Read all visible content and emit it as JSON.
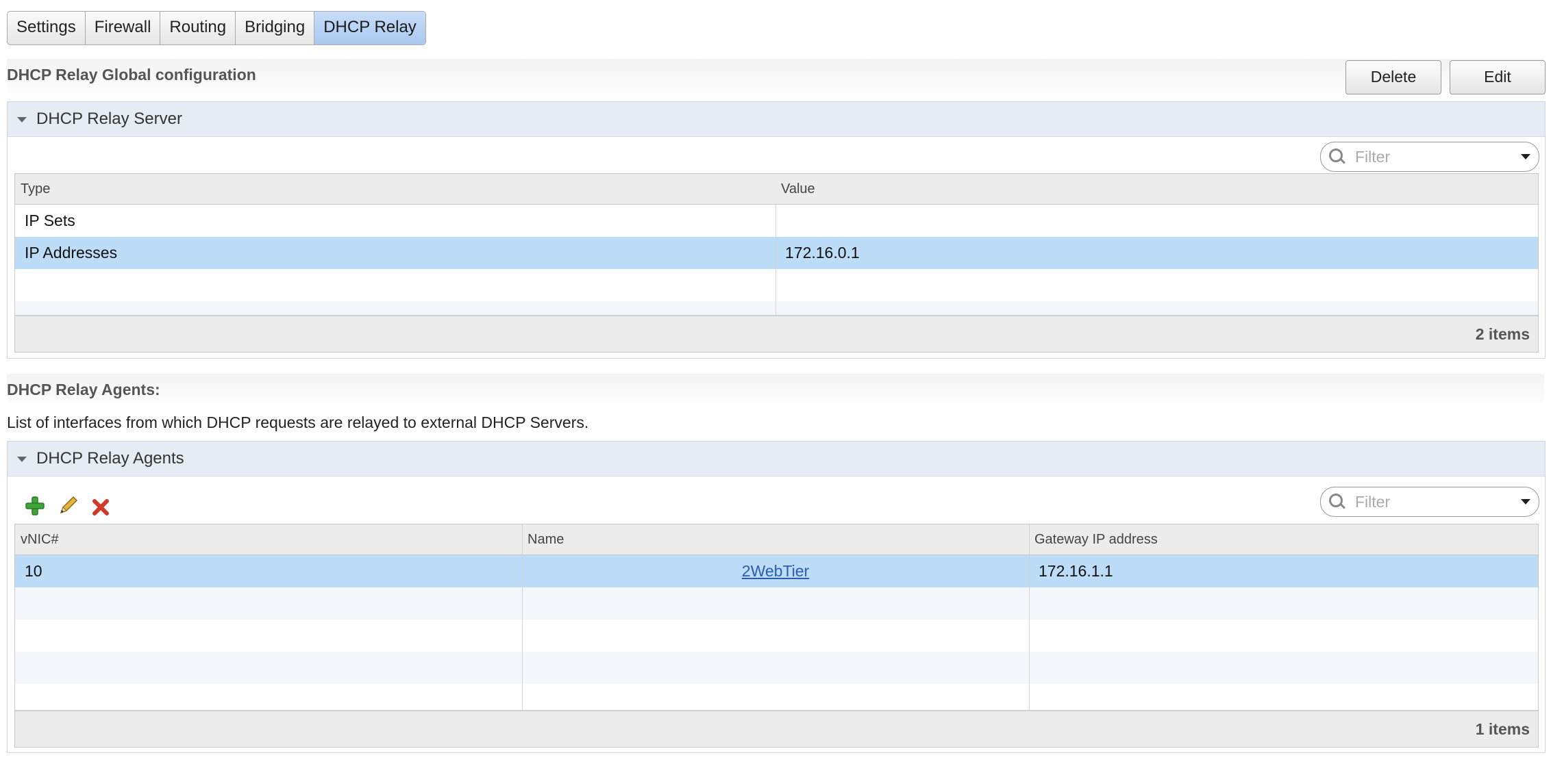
{
  "tabs": [
    {
      "label": "Settings",
      "active": false
    },
    {
      "label": "Firewall",
      "active": false
    },
    {
      "label": "Routing",
      "active": false
    },
    {
      "label": "Bridging",
      "active": false
    },
    {
      "label": "DHCP Relay",
      "active": true
    }
  ],
  "global_config": {
    "title": "DHCP Relay Global configuration",
    "delete_label": "Delete",
    "edit_label": "Edit"
  },
  "server_panel": {
    "title": "DHCP Relay Server",
    "filter_placeholder": "Filter",
    "columns": [
      "Type",
      "Value"
    ],
    "rows": [
      {
        "type": "IP Sets",
        "value": ""
      },
      {
        "type": "IP Addresses",
        "value": "172.16.0.1"
      }
    ],
    "count": "2 items"
  },
  "agents_section": {
    "title": "DHCP Relay Agents:",
    "description": "List of interfaces from which DHCP requests are relayed to external DHCP Servers."
  },
  "agents_panel": {
    "title": "DHCP Relay Agents",
    "filter_placeholder": "Filter",
    "toolbar": {
      "add_icon": "plus-icon",
      "edit_icon": "pencil-icon",
      "delete_icon": "x-icon"
    },
    "columns": [
      "vNIC#",
      "Name",
      "Gateway IP address"
    ],
    "rows": [
      {
        "vnic": "10",
        "name": "2WebTier",
        "gateway": "172.16.1.1"
      }
    ],
    "count": "1 items"
  },
  "colors": {
    "selected_row": "#bcdcf7",
    "active_tab": "#a9c8f0",
    "panel_header": "#e6ecf3",
    "link": "#2a5db0"
  }
}
